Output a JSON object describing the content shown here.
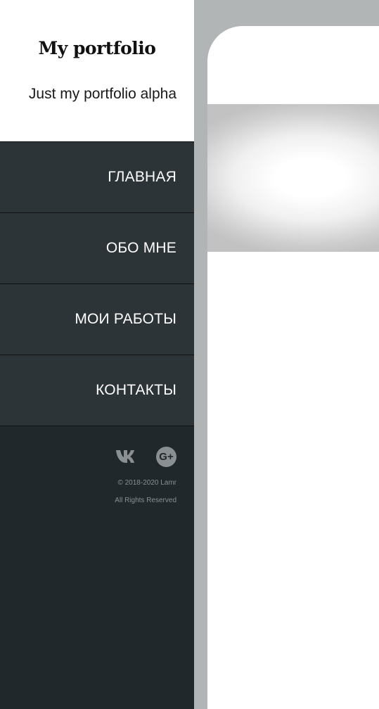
{
  "brand": {
    "title": "My portfolio",
    "tagline": "Just my portfolio alpha"
  },
  "nav": {
    "items": [
      {
        "label": "ГЛАВНАЯ"
      },
      {
        "label": "ОБО МНЕ"
      },
      {
        "label": "МОИ РАБОТЫ"
      },
      {
        "label": "КОНТАКТЫ"
      }
    ]
  },
  "footer": {
    "socials": [
      {
        "icon": "vk-icon"
      },
      {
        "icon": "google-plus-icon",
        "glyph": "G+"
      }
    ],
    "copyright": "© 2018-2020 Lamr",
    "rights": "All Rights Reserved"
  },
  "colors": {
    "sidebar_bg": "#20282b",
    "nav_bg": "#2d3437",
    "page_bg": "#b1b5b6",
    "footer_text": "#8a8f92"
  }
}
